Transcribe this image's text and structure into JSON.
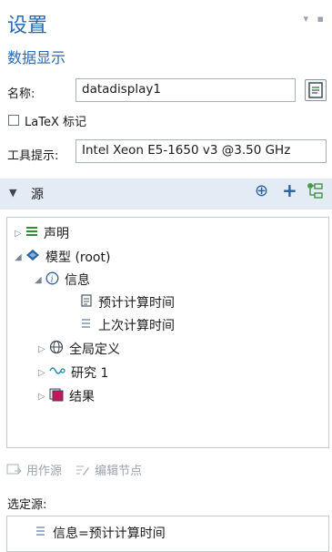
{
  "header": {
    "title": "设置",
    "subtitle": "数据显示",
    "pin_glyphs": "▾ ▪"
  },
  "form": {
    "name_label": "名称:",
    "name_value": "datadisplay1",
    "latex_label": "LaTeX 标记",
    "latex_checked": false,
    "tooltip_label": "工具提示:",
    "tooltip_value": "Intel Xeon E5-1650 v3 @3.50 GHz"
  },
  "source_section": {
    "label": "源",
    "collapse_glyph": "▼",
    "buttons": {
      "add_circle": "⊕",
      "add": "+",
      "tree_add": "⌥"
    }
  },
  "tree": {
    "items": [
      {
        "label": "声明"
      },
      {
        "label": "模型 (root)"
      },
      {
        "label": "信息"
      },
      {
        "label": "预计计算时间"
      },
      {
        "label": "上次计算时间"
      },
      {
        "label": "全局定义"
      },
      {
        "label": "研究 1"
      },
      {
        "label": "结果"
      }
    ]
  },
  "actions": {
    "use_as_source": "用作源",
    "edit_node": "编辑节点"
  },
  "selected": {
    "label": "选定源:",
    "value": "信息=预计计算时间"
  },
  "colors": {
    "accent": "#2a6bb0",
    "section_bg": "#e3ebf4",
    "border": "#c3c9cf"
  }
}
